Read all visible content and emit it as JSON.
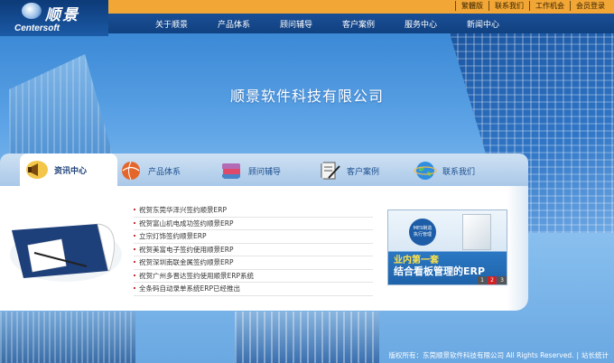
{
  "top_links": [
    "繁體版",
    "联系我们",
    "工作机会",
    "会员登录"
  ],
  "logo": {
    "cn": "顺景",
    "en": "Centersoft"
  },
  "nav": [
    "关于顺景",
    "产品体系",
    "顾问辅导",
    "客户案例",
    "服务中心",
    "新闻中心"
  ],
  "hero_title": "顺景软件科技有限公司",
  "tabs": [
    {
      "label": "资讯中心",
      "icon": "megaphone-icon",
      "color": "#e8a020"
    },
    {
      "label": "产品体系",
      "icon": "globe-icon",
      "color": "#e05a20"
    },
    {
      "label": "顾问辅导",
      "icon": "books-icon",
      "color": "#b06ab8"
    },
    {
      "label": "客户案例",
      "icon": "document-pen-icon",
      "color": "#555555"
    },
    {
      "label": "联系我们",
      "icon": "earth-icon",
      "color": "#2f8ee0"
    }
  ],
  "news": [
    "祝贺东莞华泽兴签约顺景ERP",
    "祝贺富山机电成功签约顺景ERP",
    "立宗灯饰签约顺景ERP",
    "祝贺美富电子签约使用顺景ERP",
    "祝贺深圳南联金属签约顺景ERP",
    "祝贺广州多晋达签约使用顺景ERP系统",
    "全条码自动录单系统ERP已经推出"
  ],
  "promo": {
    "badge_line1": "MES制造",
    "badge_line2": "执行管理",
    "line1": "业内第一套",
    "line2": "结合看板管理的ERP",
    "pages": [
      "1",
      "2",
      "3"
    ],
    "active_page": 2
  },
  "footer": {
    "copyright": "版权所有：东莞顺景软件科技有限公司 All Rights Reserved.",
    "stats": "站长统计"
  }
}
